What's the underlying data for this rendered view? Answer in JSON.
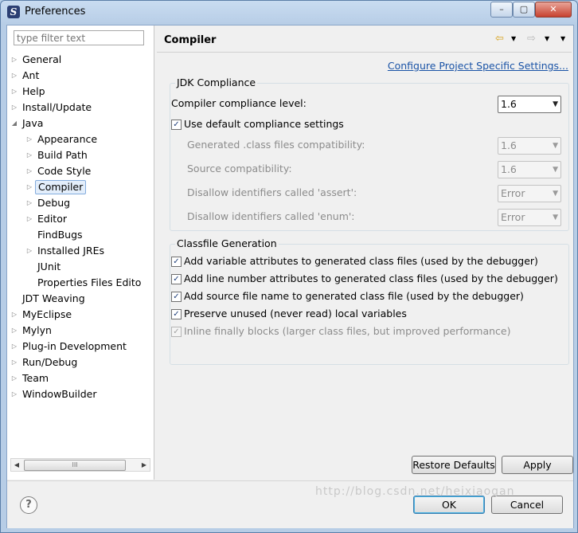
{
  "window": {
    "title": "Preferences",
    "minimize": "–",
    "maximize": "▢",
    "close": "✕"
  },
  "sidebar": {
    "filter_placeholder": "type filter text",
    "items": [
      {
        "label": "General",
        "expanded": false
      },
      {
        "label": "Ant",
        "expanded": false
      },
      {
        "label": "Help",
        "expanded": false
      },
      {
        "label": "Install/Update",
        "expanded": false
      },
      {
        "label": "Java",
        "expanded": true
      },
      {
        "label": "Appearance",
        "expanded": false
      },
      {
        "label": "Build Path",
        "expanded": false
      },
      {
        "label": "Code Style",
        "expanded": false
      },
      {
        "label": "Compiler",
        "selected": true
      },
      {
        "label": "Debug",
        "expanded": false
      },
      {
        "label": "Editor",
        "expanded": false
      },
      {
        "label": "FindBugs"
      },
      {
        "label": "Installed JREs",
        "expanded": false
      },
      {
        "label": "JUnit"
      },
      {
        "label": "Properties Files Edito"
      },
      {
        "label": "JDT Weaving"
      },
      {
        "label": "MyEclipse",
        "expanded": false
      },
      {
        "label": "Mylyn",
        "expanded": false
      },
      {
        "label": "Plug-in Development",
        "expanded": false
      },
      {
        "label": "Run/Debug",
        "expanded": false
      },
      {
        "label": "Team",
        "expanded": false
      },
      {
        "label": "WindowBuilder",
        "expanded": false
      }
    ],
    "scroll_thumb": "III"
  },
  "page": {
    "title": "Compiler",
    "config_link": "Configure Project Specific Settings...",
    "jdk_group": {
      "title": "JDK Compliance",
      "compliance_label": "Compiler compliance level:",
      "compliance_value": "1.6",
      "use_default_label": "Use default compliance settings",
      "use_default_checked": true,
      "rows": [
        {
          "label": "Generated .class files compatibility:",
          "value": "1.6"
        },
        {
          "label": "Source compatibility:",
          "value": "1.6"
        },
        {
          "label": "Disallow identifiers called 'assert':",
          "value": "Error"
        },
        {
          "label": "Disallow identifiers called 'enum':",
          "value": "Error"
        }
      ]
    },
    "classfile_group": {
      "title": "Classfile Generation",
      "options": [
        {
          "label": "Add variable attributes to generated class files (used by the debugger)",
          "checked": true,
          "enabled": true
        },
        {
          "label": "Add line number attributes to generated class files (used by the debugger)",
          "checked": true,
          "enabled": true
        },
        {
          "label": "Add source file name to generated class file (used by the debugger)",
          "checked": true,
          "enabled": true
        },
        {
          "label": "Preserve unused (never read) local variables",
          "checked": true,
          "enabled": true
        },
        {
          "label": "Inline finally blocks (larger class files, but improved performance)",
          "checked": true,
          "enabled": false
        }
      ]
    },
    "restore_defaults": "Restore Defaults",
    "apply": "Apply"
  },
  "footer": {
    "help": "?",
    "ok": "OK",
    "cancel": "Cancel",
    "watermark": "http://blog.csdn.net/heixiaogan"
  },
  "colors": {
    "link": "#1a53a6",
    "selection": "#e3eefb"
  }
}
